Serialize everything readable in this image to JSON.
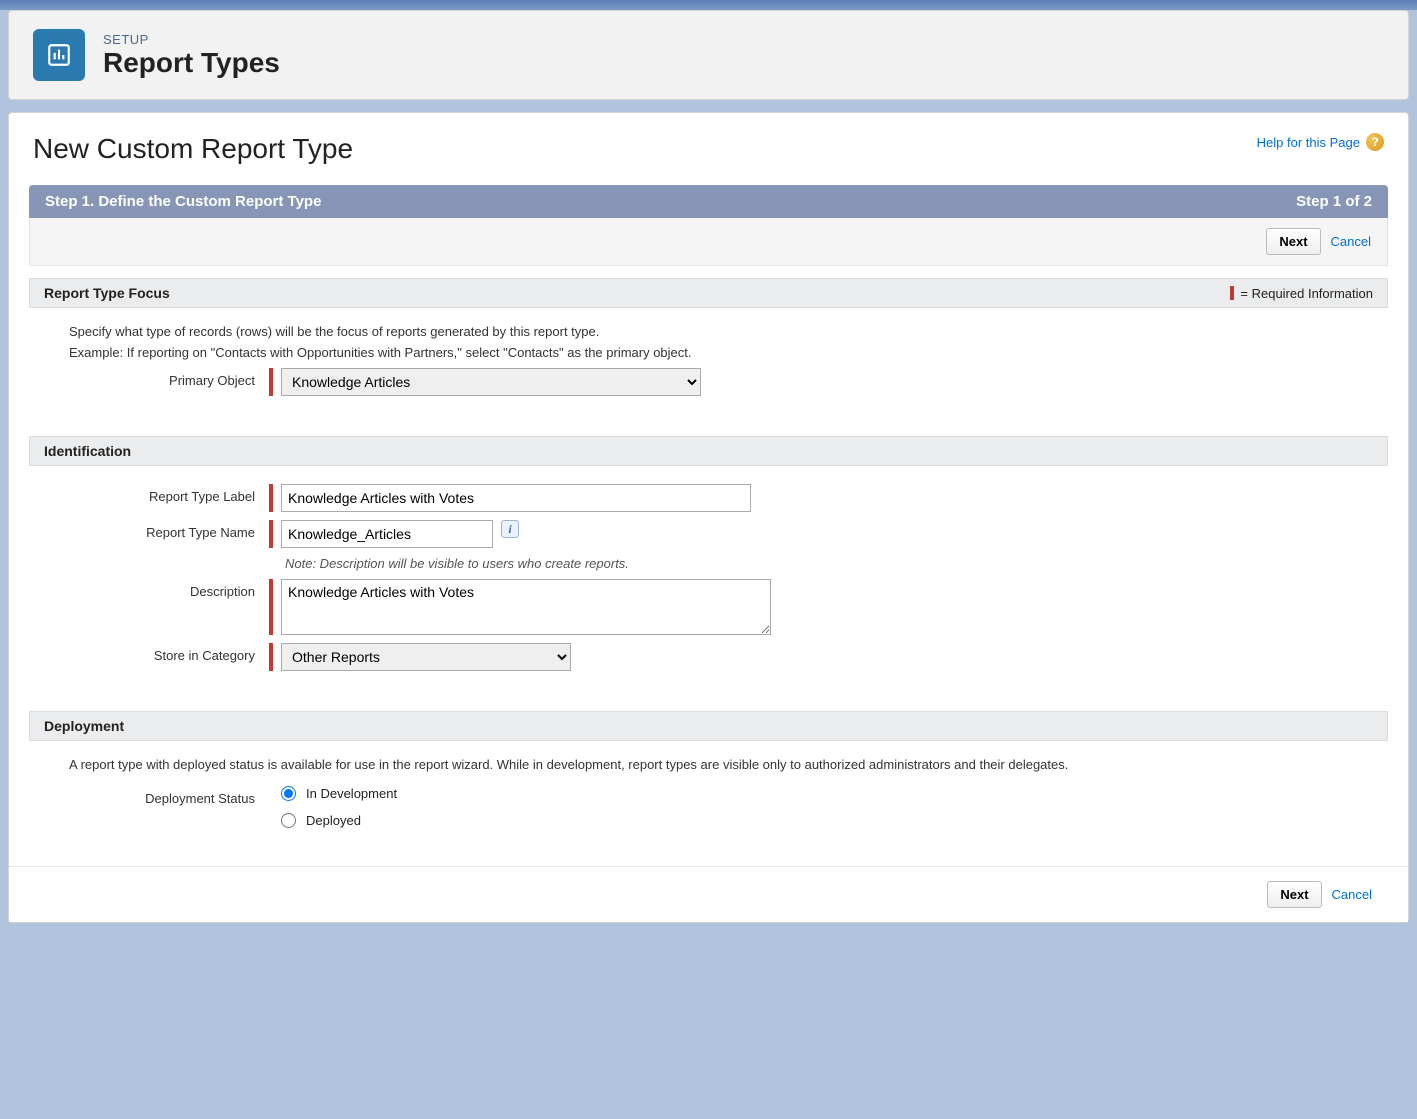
{
  "header": {
    "eyebrow": "SETUP",
    "title": "Report Types"
  },
  "page": {
    "title": "New Custom Report Type",
    "help_label": "Help for this Page"
  },
  "step": {
    "left": "Step 1. Define the Custom Report Type",
    "right": "Step 1 of 2"
  },
  "actions": {
    "next": "Next",
    "cancel": "Cancel"
  },
  "focus": {
    "heading": "Report Type Focus",
    "required_label": "= Required Information",
    "desc1": "Specify what type of records (rows) will be the focus of reports generated by this report type.",
    "desc2": "Example: If reporting on \"Contacts with Opportunities with Partners,\" select \"Contacts\" as the primary object.",
    "primary_object_label": "Primary Object",
    "primary_object_value": "Knowledge Articles"
  },
  "ident": {
    "heading": "Identification",
    "label_label": "Report Type Label",
    "label_value": "Knowledge Articles with Votes",
    "name_label": "Report Type Name",
    "name_value": "Knowledge_Articles",
    "note": "Note: Description will be visible to users who create reports.",
    "description_label": "Description",
    "description_value": "Knowledge Articles with Votes",
    "category_label": "Store in Category",
    "category_value": "Other Reports"
  },
  "deploy": {
    "heading": "Deployment",
    "desc": "A report type with deployed status is available for use in the report wizard. While in development, report types are visible only to authorized administrators and their delegates.",
    "status_label": "Deployment Status",
    "option_dev": "In Development",
    "option_deployed": "Deployed"
  }
}
